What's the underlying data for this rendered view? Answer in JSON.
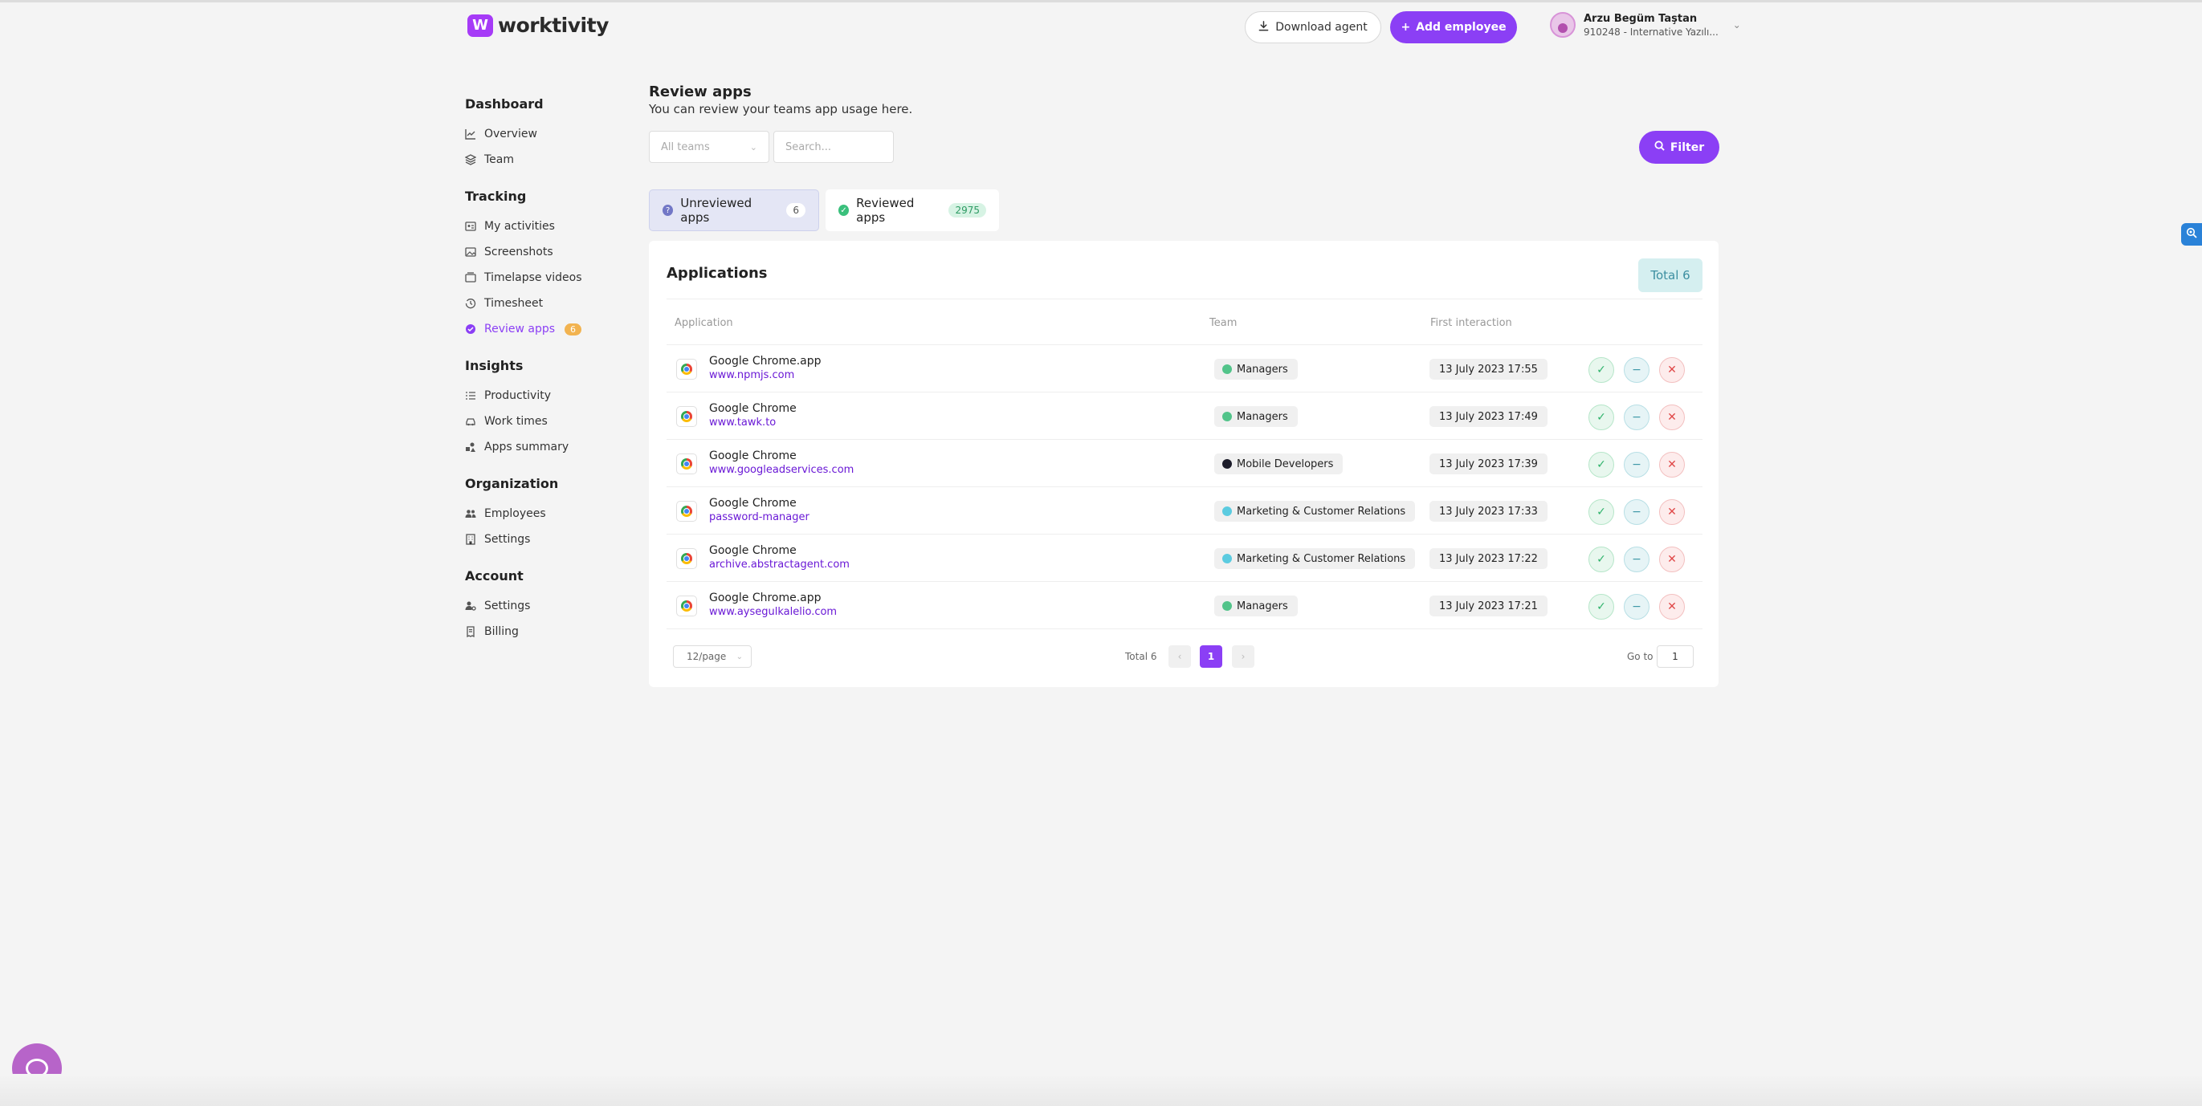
{
  "brand": {
    "name": "worktivity",
    "mark": "W"
  },
  "header": {
    "download_label": "Download agent",
    "add_employee_label": "Add employee",
    "user_name": "Arzu Begüm Taştan",
    "user_org": "910248 - Internative Yazılı..."
  },
  "sidebar": {
    "sections": [
      {
        "title": "Dashboard",
        "items": [
          {
            "label": "Overview",
            "icon": "chart-line-icon"
          },
          {
            "label": "Team",
            "icon": "layers-icon"
          }
        ]
      },
      {
        "title": "Tracking",
        "items": [
          {
            "label": "My activities",
            "icon": "id-card-icon"
          },
          {
            "label": "Screenshots",
            "icon": "image-icon"
          },
          {
            "label": "Timelapse videos",
            "icon": "video-icon"
          },
          {
            "label": "Timesheet",
            "icon": "history-icon"
          },
          {
            "label": "Review apps",
            "icon": "check-circle-icon",
            "badge": "6",
            "active": true
          }
        ]
      },
      {
        "title": "Insights",
        "items": [
          {
            "label": "Productivity",
            "icon": "list-icon"
          },
          {
            "label": "Work times",
            "icon": "car-icon"
          },
          {
            "label": "Apps summary",
            "icon": "shapes-icon"
          }
        ]
      },
      {
        "title": "Organization",
        "items": [
          {
            "label": "Employees",
            "icon": "users-icon"
          },
          {
            "label": "Settings",
            "icon": "building-icon"
          }
        ]
      },
      {
        "title": "Account",
        "items": [
          {
            "label": "Settings",
            "icon": "user-cog-icon"
          },
          {
            "label": "Billing",
            "icon": "receipt-icon"
          }
        ]
      }
    ]
  },
  "page": {
    "title": "Review apps",
    "subtitle": "You can review your teams app usage here.",
    "teams_select": "All teams",
    "search_placeholder": "Search...",
    "filter_label": "Filter"
  },
  "tabs": [
    {
      "label": "Unreviewed apps",
      "count": "6",
      "selected": true
    },
    {
      "label": "Reviewed apps",
      "count": "2975",
      "selected": false
    }
  ],
  "table": {
    "title": "Applications",
    "total": "Total 6",
    "columns": [
      "Application",
      "Team",
      "First interaction"
    ],
    "rows": [
      {
        "app": "Google Chrome.app",
        "url": "www.npmjs.com",
        "team": "Managers",
        "team_color": "#52c48a",
        "date": "13 July 2023 17:55"
      },
      {
        "app": "Google Chrome",
        "url": "www.tawk.to",
        "team": "Managers",
        "team_color": "#52c48a",
        "date": "13 July 2023 17:49"
      },
      {
        "app": "Google Chrome",
        "url": "www.googleadservices.com",
        "team": "Mobile Developers",
        "team_color": "#1c1c2a",
        "date": "13 July 2023 17:39"
      },
      {
        "app": "Google Chrome",
        "url": "password-manager",
        "team": "Marketing & Customer Relations",
        "team_color": "#5bcbe0",
        "date": "13 July 2023 17:33"
      },
      {
        "app": "Google Chrome",
        "url": "archive.abstractagent.com",
        "team": "Marketing & Customer Relations",
        "team_color": "#5bcbe0",
        "date": "13 July 2023 17:22"
      },
      {
        "app": "Google Chrome.app",
        "url": "www.aysegulkalelio.com",
        "team": "Managers",
        "team_color": "#52c48a",
        "date": "13 July 2023 17:21"
      }
    ]
  },
  "pagination": {
    "page_size": "12/page",
    "total": "Total 6",
    "current_page": "1",
    "goto_label": "Go to",
    "goto_value": "1"
  },
  "colors": {
    "accent": "#8b3ff5",
    "badge": "#f2b350"
  }
}
